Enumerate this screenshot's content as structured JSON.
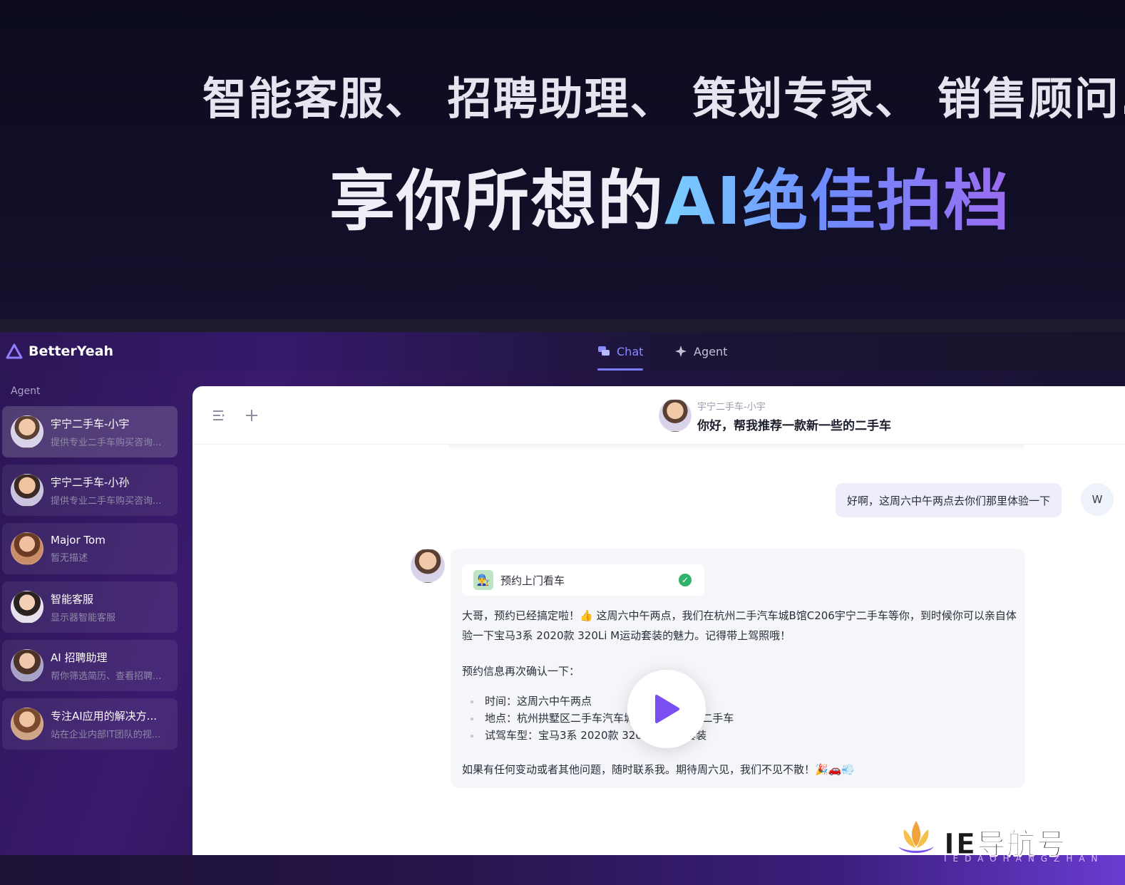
{
  "hero": {
    "line1": "智能客服、 招聘助理、 策划专家、 销售顾问...",
    "line2_plain": "享你所想的",
    "line2_highlight": "AI绝佳拍档"
  },
  "topbar": {
    "brand": "BetterYeah",
    "tabs": [
      {
        "label": "Chat",
        "active": true,
        "icon": "chat-bubbles-icon"
      },
      {
        "label": "Agent",
        "active": false,
        "icon": "sparkle-icon"
      }
    ]
  },
  "sidebar": {
    "heading": "Agent",
    "items": [
      {
        "name": "宇宁二手车-小宇",
        "desc": "提供专业二手车购买咨询...",
        "active": true
      },
      {
        "name": "宇宁二手车-小孙",
        "desc": "提供专业二手车购买咨询...",
        "active": false
      },
      {
        "name": "Major Tom",
        "desc": "暂无描述",
        "active": false
      },
      {
        "name": "智能客服",
        "desc": "显示器智能客服",
        "active": false
      },
      {
        "name": "AI 招聘助理",
        "desc": "帮你筛选简历、查看招聘...",
        "active": false
      },
      {
        "name": "专注AI应用的解决方...",
        "desc": "站在企业内部IT团队的视...",
        "active": false
      }
    ]
  },
  "chat": {
    "header": {
      "agent_name": "宇宁二手车-小宇",
      "title": "你好，帮我推荐一款新一些的二手车"
    },
    "user_message": "好啊，这周六中午两点去你们那里体验一下",
    "user_avatar_letter": "W",
    "bot_message": {
      "tool_name": "预约上门看车",
      "tool_icon": "👨‍🔧",
      "paragraph1": "大哥，预约已经搞定啦！👍 这周六中午两点，我们在杭州二手汽车城B馆C206宇宁二手车等你，到时候你可以亲自体验一下宝马3系 2020款 320Li M运动套装的魅力。记得带上驾照哦！",
      "paragraph2": "预约信息再次确认一下：",
      "list": [
        "时间：这周六中午两点",
        "地点：杭州拱墅区二手车汽车城B馆C206宇宁二手车",
        "试驾车型：宝马3系 2020款 320Li M运动套装"
      ],
      "paragraph3": "如果有任何变动或者其他问题，随时联系我。期待周六见，我们不见不散！🎉🚗💨"
    }
  },
  "watermark": {
    "text": "IE导航号",
    "sub": "IEDAOHANGZHAN"
  },
  "colors": {
    "accent": "#7b7dff",
    "check": "#2fb36b"
  }
}
